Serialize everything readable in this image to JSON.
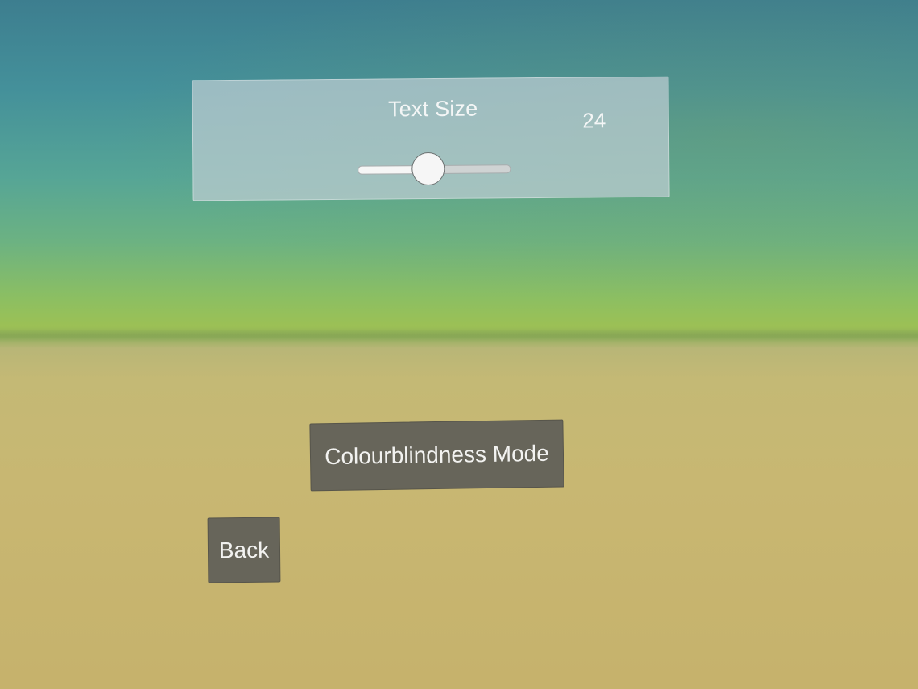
{
  "settings_panel": {
    "text_size_label": "Text Size",
    "text_size_value": "24",
    "slider_fraction": 0.47
  },
  "buttons": {
    "colourblindness_mode_label": "Colourblindness Mode",
    "back_label": "Back"
  },
  "colors": {
    "panel": "#bfcdd2",
    "button": "#67655a",
    "sky_top": "#3d7e8f",
    "ground": "#c6b26c"
  }
}
